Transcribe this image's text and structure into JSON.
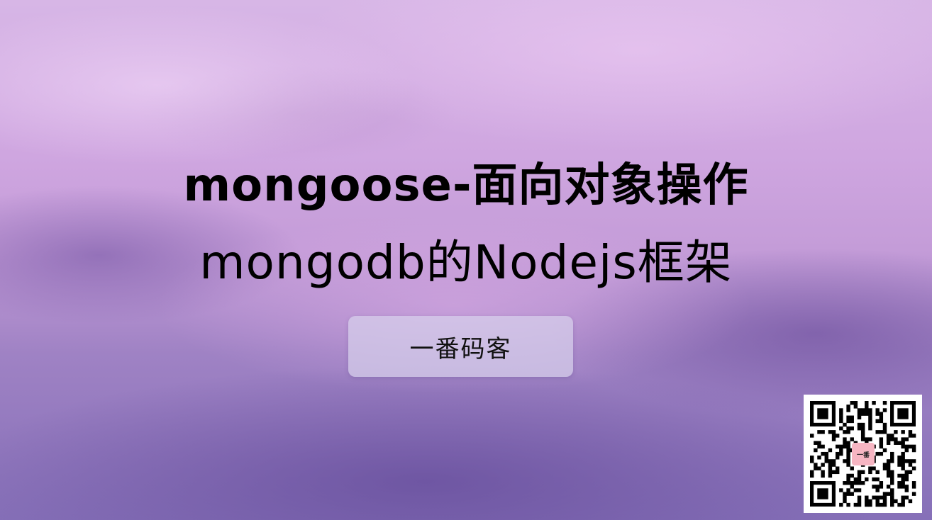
{
  "slide": {
    "title_line_1": "mongoose-面向对象操作",
    "title_line_2": "mongodb的Nodejs框架",
    "author": "一番码客"
  },
  "qr_code": {
    "icon": "qr-code-icon",
    "logo_text": "一番"
  },
  "colors": {
    "title_text": "#000000",
    "badge_background": "#d7d0eb",
    "qr_logo_background": "#f6b5c2"
  }
}
